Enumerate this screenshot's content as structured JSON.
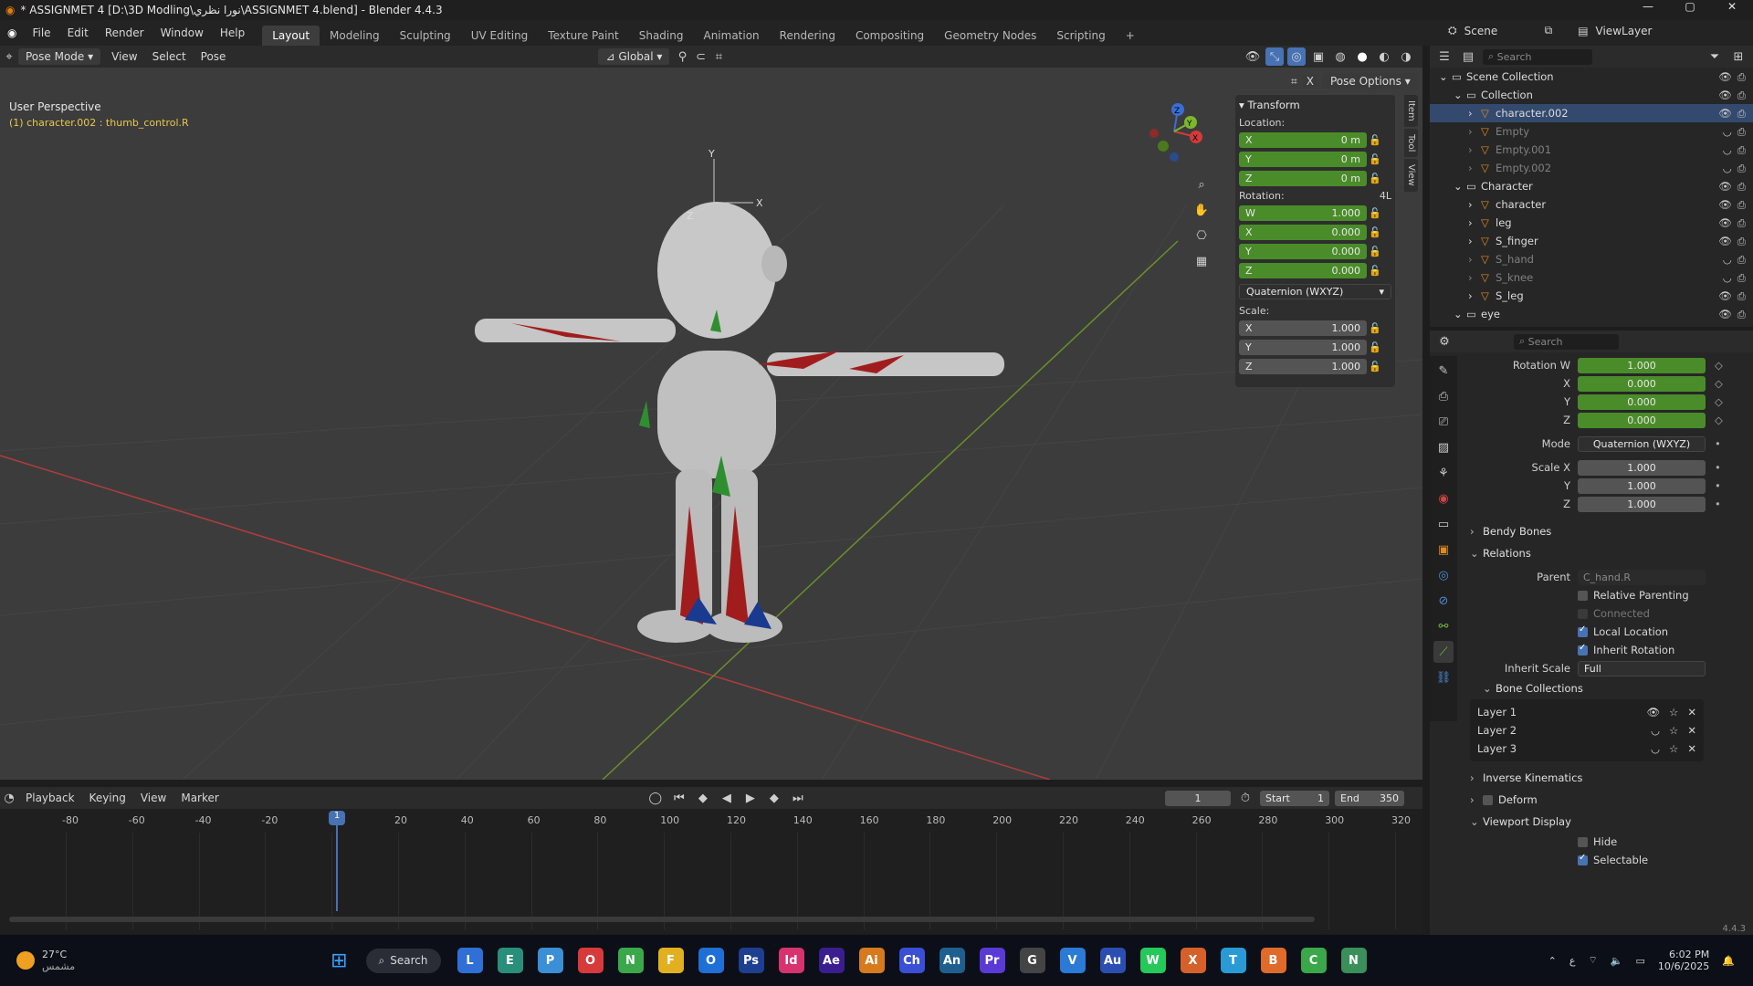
{
  "titlebar": {
    "title": "* ASSIGNMET 4 [D:\\3D Modling\\نورا نظري\\ASSIGNMET 4.blend] - Blender 4.4.3",
    "min": "—",
    "max": "▢",
    "close": "✕"
  },
  "menu": [
    "File",
    "Edit",
    "Render",
    "Window",
    "Help"
  ],
  "workspaces": [
    "Layout",
    "Modeling",
    "Sculpting",
    "UV Editing",
    "Texture Paint",
    "Shading",
    "Animation",
    "Rendering",
    "Compositing",
    "Geometry Nodes",
    "Scripting"
  ],
  "active_workspace": "Layout",
  "scene": {
    "label": "Scene",
    "viewlayer": "ViewLayer"
  },
  "viewport_header": {
    "mode": "Pose Mode",
    "view": "View",
    "select": "Select",
    "pose": "Pose",
    "orientation": "Global",
    "pose_options": "Pose Options"
  },
  "viewport": {
    "perspective": "User Perspective",
    "active": "(1) character.002 : thumb_control.R",
    "gizmo": {
      "x": "X",
      "y": "Y",
      "z": "Z"
    }
  },
  "npanel": {
    "tabs": [
      "Item",
      "Tool",
      "View"
    ],
    "transform": "Transform",
    "location_label": "Location:",
    "location": [
      {
        "axis": "X",
        "val": "0 m"
      },
      {
        "axis": "Y",
        "val": "0 m"
      },
      {
        "axis": "Z",
        "val": "0 m"
      }
    ],
    "rotation_label": "Rotation:",
    "rotation_tag": "4L",
    "rotation": [
      {
        "axis": "W",
        "val": "1.000"
      },
      {
        "axis": "X",
        "val": "0.000"
      },
      {
        "axis": "Y",
        "val": "0.000"
      },
      {
        "axis": "Z",
        "val": "0.000"
      }
    ],
    "rotation_mode": "Quaternion (WXYZ)",
    "scale_label": "Scale:",
    "scale": [
      {
        "axis": "X",
        "val": "1.000"
      },
      {
        "axis": "Y",
        "val": "1.000"
      },
      {
        "axis": "Z",
        "val": "1.000"
      }
    ]
  },
  "timeline": {
    "playback": "Playback",
    "keying": "Keying",
    "view": "View",
    "marker": "Marker",
    "frame": "1",
    "start_label": "Start",
    "start": "1",
    "end_label": "End",
    "end": "350",
    "ticks": [
      "-80",
      "-60",
      "-40",
      "-20",
      "1",
      "20",
      "40",
      "60",
      "80",
      "100",
      "120",
      "140",
      "160",
      "180",
      "200",
      "220",
      "240",
      "260",
      "280",
      "300",
      "320"
    ]
  },
  "outliner": {
    "search": "Search",
    "rows": [
      {
        "name": "Scene Collection",
        "indent": 0,
        "dim": false,
        "sel": false
      },
      {
        "name": "Collection",
        "indent": 1,
        "dim": false,
        "sel": false
      },
      {
        "name": "character.002",
        "indent": 2,
        "dim": false,
        "sel": true
      },
      {
        "name": "Empty",
        "indent": 2,
        "dim": true,
        "sel": false
      },
      {
        "name": "Empty.001",
        "indent": 2,
        "dim": true,
        "sel": false
      },
      {
        "name": "Empty.002",
        "indent": 2,
        "dim": true,
        "sel": false
      },
      {
        "name": "Character",
        "indent": 1,
        "dim": false,
        "sel": false
      },
      {
        "name": "character",
        "indent": 2,
        "dim": false,
        "sel": false
      },
      {
        "name": "leg",
        "indent": 2,
        "dim": false,
        "sel": false
      },
      {
        "name": "S_finger",
        "indent": 2,
        "dim": false,
        "sel": false
      },
      {
        "name": "S_hand",
        "indent": 2,
        "dim": true,
        "sel": false
      },
      {
        "name": "S_knee",
        "indent": 2,
        "dim": true,
        "sel": false
      },
      {
        "name": "S_leg",
        "indent": 2,
        "dim": false,
        "sel": false
      },
      {
        "name": "eye",
        "indent": 1,
        "dim": false,
        "sel": false
      }
    ]
  },
  "props": {
    "search": "Search",
    "rot_w_label": "Rotation W",
    "rot_w": "1.000",
    "rot_x_label": "X",
    "rot_x": "0.000",
    "rot_y_label": "Y",
    "rot_y": "0.000",
    "rot_z_label": "Z",
    "rot_z": "0.000",
    "mode_label": "Mode",
    "mode": "Quaternion (WXYZ)",
    "scale_x_label": "Scale X",
    "scale_x": "1.000",
    "scale_y_label": "Y",
    "scale_y": "1.000",
    "scale_z_label": "Z",
    "scale_z": "1.000",
    "bendy": "Bendy Bones",
    "relations": "Relations",
    "parent_label": "Parent",
    "parent": "C_hand.R",
    "relative_parenting": "Relative Parenting",
    "connected": "Connected",
    "local_location": "Local Location",
    "inherit_rotation": "Inherit Rotation",
    "inherit_scale_label": "Inherit Scale",
    "inherit_scale": "Full",
    "bone_collections": "Bone Collections",
    "layers": [
      "Layer 1",
      "Layer 2",
      "Layer 3"
    ],
    "ik": "Inverse Kinematics",
    "deform": "Deform",
    "viewport_display": "Viewport Display",
    "hide": "Hide",
    "selectable": "Selectable",
    "version": "4.4.3"
  },
  "taskbar": {
    "weather_temp": "27°C",
    "weather_desc": "مشمس",
    "search": "Search",
    "time": "6:02 PM",
    "date": "10/6/2025",
    "lang": "ع",
    "apps": [
      "L",
      "E",
      "P",
      "O",
      "N",
      "F",
      "O",
      "Ps",
      "Id",
      "Ae",
      "Ai",
      "Ch",
      "An",
      "Pr",
      "G",
      "V",
      "Au",
      "W",
      "X",
      "T",
      "B",
      "C",
      "N"
    ]
  }
}
